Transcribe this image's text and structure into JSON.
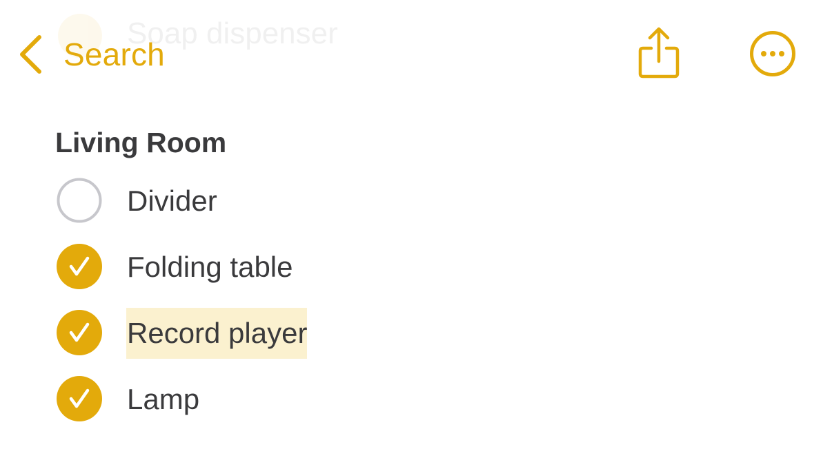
{
  "nav": {
    "back_label": "Search"
  },
  "ghost_item": {
    "label": "Soap dispenser"
  },
  "section": {
    "title": "Living Room"
  },
  "items": [
    {
      "label": "Divider",
      "checked": false
    },
    {
      "label": "Folding table",
      "checked": true
    },
    {
      "label": "Record player",
      "checked": true,
      "highlighted": true
    },
    {
      "label": "Lamp",
      "checked": true
    }
  ],
  "colors": {
    "accent": "#E3AA0B",
    "text": "#3a3a3c",
    "unchecked_ring": "#c7c7cc",
    "highlight": "#FBF1CF"
  },
  "icons": {
    "back": "chevron-left-icon",
    "share": "share-icon",
    "more": "ellipsis-circle-icon",
    "checked": "checkmark-circle-icon",
    "unchecked": "empty-circle-icon"
  }
}
